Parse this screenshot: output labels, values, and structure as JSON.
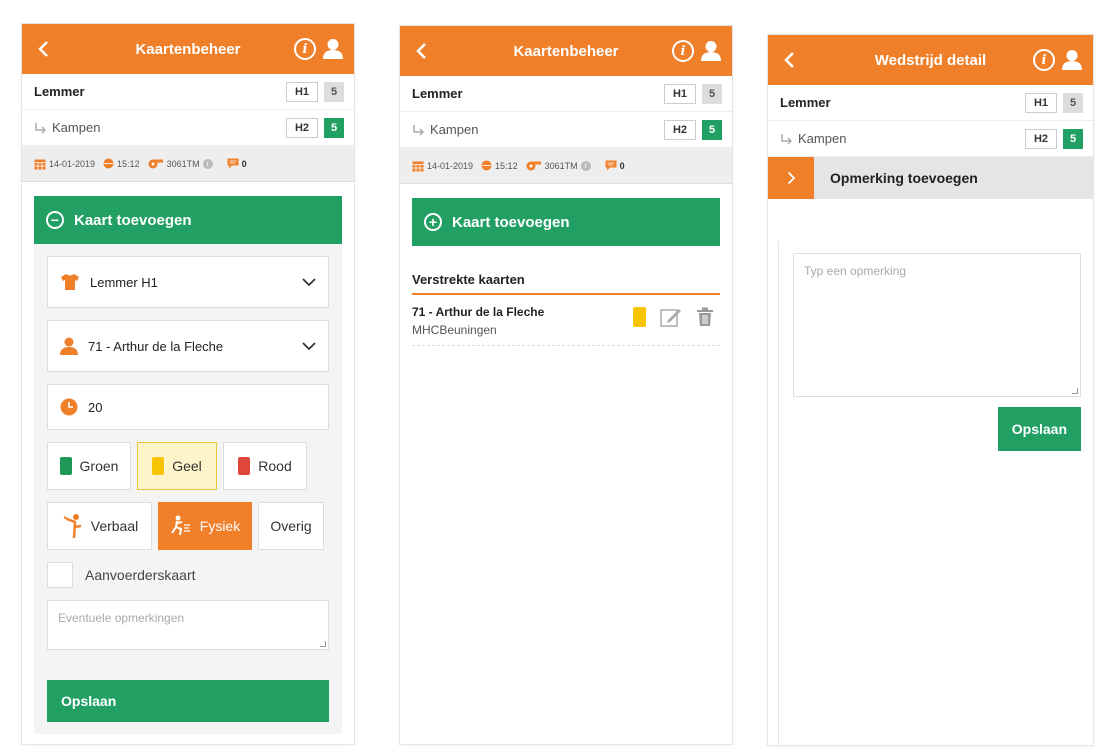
{
  "screens": [
    {
      "title": "Kaartenbeheer",
      "home_team": {
        "name": "Lemmer",
        "tag": "H1",
        "score": "5"
      },
      "away_team": {
        "name": "Kampen",
        "tag": "H2",
        "score": "5"
      },
      "meta": {
        "date": "14-01-2019",
        "time": "15:12",
        "referee": "3061TM",
        "comments": "0"
      },
      "add_card_label": "Kaart toevoegen",
      "team_select": "Lemmer H1",
      "player_select": "71 - Arthur de la Fleche",
      "minute": "20",
      "card_colors": [
        {
          "label": "Groen",
          "color": "#1f9a56"
        },
        {
          "label": "Geel",
          "color": "#f6c400"
        },
        {
          "label": "Rood",
          "color": "#e0473b"
        }
      ],
      "card_types": [
        "Verbaal",
        "Fysiek",
        "Overig"
      ],
      "captain_card_label": "Aanvoerderskaart",
      "remarks_placeholder": "Eventuele opmerkingen",
      "save_label": "Opslaan"
    },
    {
      "title": "Kaartenbeheer",
      "home_team": {
        "name": "Lemmer",
        "tag": "H1",
        "score": "5"
      },
      "away_team": {
        "name": "Kampen",
        "tag": "H2",
        "score": "5"
      },
      "meta": {
        "date": "14-01-2019",
        "time": "15:12",
        "referee": "3061TM",
        "comments": "0"
      },
      "add_card_label": "Kaart toevoegen",
      "issued_header": "Verstrekte kaarten",
      "issued": [
        {
          "player": "71 - Arthur de la Fleche",
          "club": "MHCBeuningen",
          "card_color": "#f6c400"
        }
      ]
    },
    {
      "title": "Wedstrijd detail",
      "home_team": {
        "name": "Lemmer",
        "tag": "H1",
        "score": "5"
      },
      "away_team": {
        "name": "Kampen",
        "tag": "H2",
        "score": "5"
      },
      "section_label": "Opmerking toevoegen",
      "remark_placeholder": "Typ een opmerking",
      "save_label": "Opslaan"
    }
  ],
  "colors": {
    "brand": "#f07f2a",
    "green": "#22a064"
  },
  "icons": [
    "back-icon",
    "info-icon",
    "user-icon",
    "calendar-icon",
    "ball-icon",
    "whistle-icon",
    "comment-icon",
    "shirt-icon",
    "person-icon",
    "clock-icon",
    "edit-icon",
    "trash-icon",
    "chevron-down-icon",
    "chevron-right-icon",
    "minus-circle-icon",
    "plus-circle-icon",
    "arrow-return-icon"
  ]
}
